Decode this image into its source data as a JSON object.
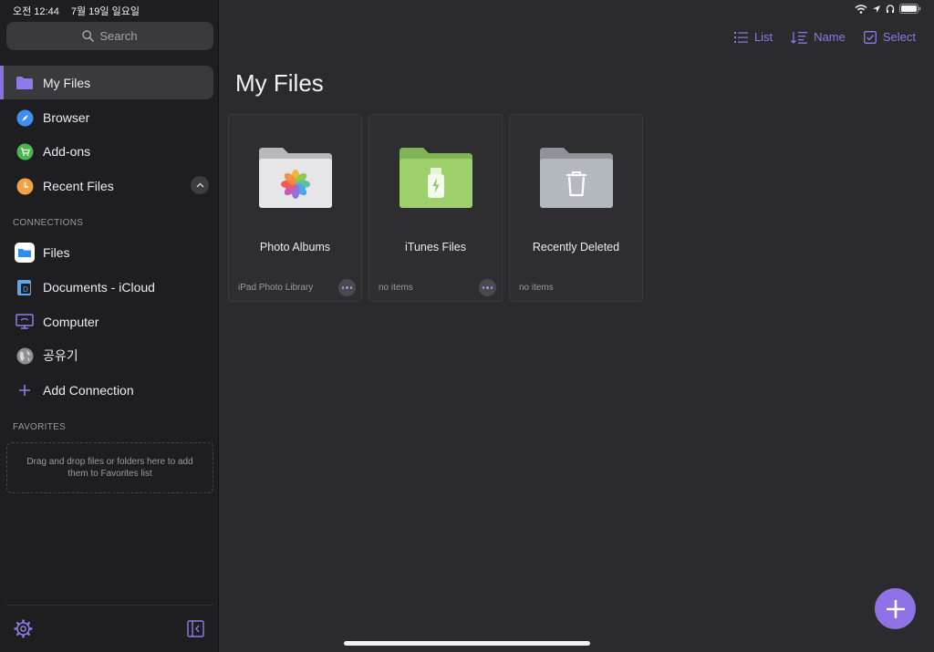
{
  "status_bar": {
    "time": "오전 12:44",
    "date": "7월 19일 일요일"
  },
  "search": {
    "placeholder": "Search"
  },
  "sidebar": {
    "items": [
      {
        "label": "My Files",
        "icon": "folder-icon",
        "active": true
      },
      {
        "label": "Browser",
        "icon": "compass-icon"
      },
      {
        "label": "Add-ons",
        "icon": "cart-icon"
      },
      {
        "label": "Recent Files",
        "icon": "clock-icon"
      }
    ],
    "connections_header": "CONNECTIONS",
    "connections": [
      {
        "label": "Files",
        "icon": "files-app-icon"
      },
      {
        "label": "Documents - iCloud",
        "icon": "documents-icon"
      },
      {
        "label": "Computer",
        "icon": "computer-icon"
      },
      {
        "label": "공유기",
        "icon": "globe-icon"
      },
      {
        "label": "Add Connection",
        "icon": "plus-icon"
      }
    ],
    "favorites_header": "FAVORITES",
    "favorites_hint": "Drag and drop files or folders here to add them to Favorites list"
  },
  "toolbar": {
    "list_label": "List",
    "sort_label": "Name",
    "select_label": "Select"
  },
  "page_title": "My Files",
  "cards": [
    {
      "name": "Photo Albums",
      "meta": "iPad Photo Library",
      "icon": "photos-folder-icon"
    },
    {
      "name": "iTunes Files",
      "meta": "no items",
      "icon": "itunes-folder-icon"
    },
    {
      "name": "Recently Deleted",
      "meta": "no items",
      "icon": "trash-folder-icon"
    }
  ],
  "colors": {
    "accent": "#8b7ae8",
    "fab": "#8f72e4",
    "green_folder": "#9ed06b"
  }
}
